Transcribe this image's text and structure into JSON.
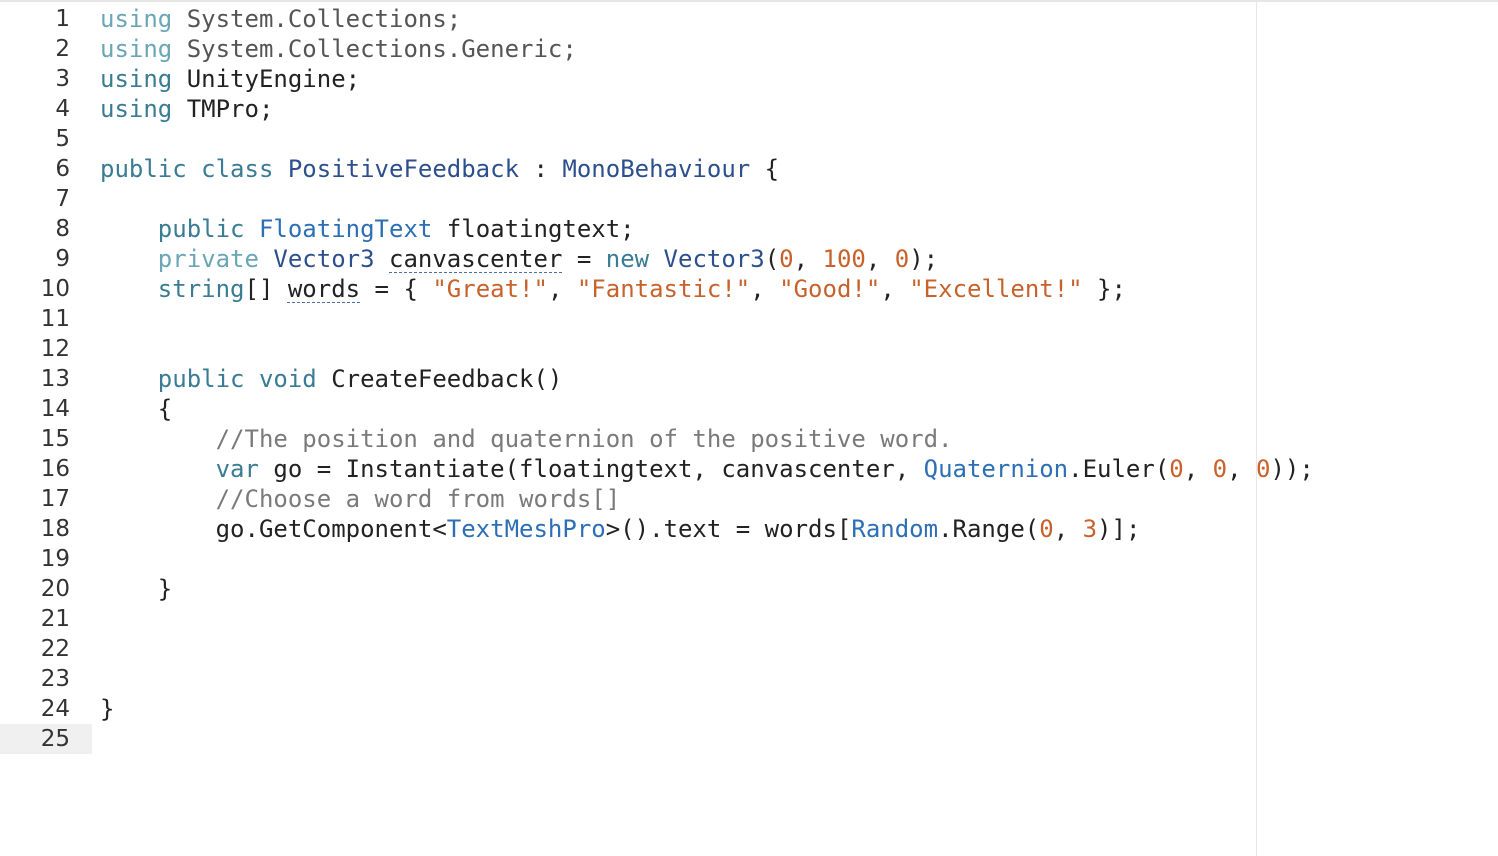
{
  "editor": {
    "language": "C#",
    "current_line": 25,
    "lines": [
      {
        "n": "1",
        "tokens": [
          {
            "t": "using",
            "c": "kwfaded"
          },
          {
            "t": " System.Collections;",
            "c": "ns"
          }
        ]
      },
      {
        "n": "2",
        "tokens": [
          {
            "t": "using",
            "c": "kwfaded"
          },
          {
            "t": " System.Collections.Generic;",
            "c": "ns"
          }
        ]
      },
      {
        "n": "3",
        "tokens": [
          {
            "t": "using",
            "c": "kw"
          },
          {
            "t": " UnityEngine;",
            "c": "plain"
          }
        ]
      },
      {
        "n": "4",
        "tokens": [
          {
            "t": "using",
            "c": "kw"
          },
          {
            "t": " TMPro;",
            "c": "plain"
          }
        ]
      },
      {
        "n": "5",
        "tokens": []
      },
      {
        "n": "6",
        "tokens": [
          {
            "t": "public class ",
            "c": "kw"
          },
          {
            "t": "PositiveFeedback",
            "c": "type"
          },
          {
            "t": " : ",
            "c": "plain"
          },
          {
            "t": "MonoBehaviour",
            "c": "type"
          },
          {
            "t": " {",
            "c": "plain"
          }
        ]
      },
      {
        "n": "7",
        "tokens": []
      },
      {
        "n": "8",
        "tokens": [
          {
            "t": "    ",
            "c": "plain"
          },
          {
            "t": "public ",
            "c": "kw"
          },
          {
            "t": "FloatingText",
            "c": "typeb"
          },
          {
            "t": " floatingtext;",
            "c": "plain"
          }
        ]
      },
      {
        "n": "9",
        "tokens": [
          {
            "t": "    ",
            "c": "plain"
          },
          {
            "t": "private ",
            "c": "kwfaded"
          },
          {
            "t": "Vector3",
            "c": "type"
          },
          {
            "t": " ",
            "c": "plain"
          },
          {
            "t": "canvascenter",
            "c": "plain squiggle"
          },
          {
            "t": " = ",
            "c": "plain"
          },
          {
            "t": "new ",
            "c": "kw"
          },
          {
            "t": "Vector3",
            "c": "type"
          },
          {
            "t": "(",
            "c": "plain"
          },
          {
            "t": "0",
            "c": "num"
          },
          {
            "t": ", ",
            "c": "plain"
          },
          {
            "t": "100",
            "c": "num"
          },
          {
            "t": ", ",
            "c": "plain"
          },
          {
            "t": "0",
            "c": "num"
          },
          {
            "t": ");",
            "c": "plain"
          }
        ]
      },
      {
        "n": "10",
        "tokens": [
          {
            "t": "    ",
            "c": "plain"
          },
          {
            "t": "string",
            "c": "kw"
          },
          {
            "t": "[] ",
            "c": "plain"
          },
          {
            "t": "words",
            "c": "plain squiggle"
          },
          {
            "t": " = { ",
            "c": "plain"
          },
          {
            "t": "\"Great!\"",
            "c": "str"
          },
          {
            "t": ", ",
            "c": "plain"
          },
          {
            "t": "\"Fantastic!\"",
            "c": "str"
          },
          {
            "t": ", ",
            "c": "plain"
          },
          {
            "t": "\"Good!\"",
            "c": "str"
          },
          {
            "t": ", ",
            "c": "plain"
          },
          {
            "t": "\"Excellent!\"",
            "c": "str"
          },
          {
            "t": " };",
            "c": "plain"
          }
        ]
      },
      {
        "n": "11",
        "tokens": []
      },
      {
        "n": "12",
        "tokens": []
      },
      {
        "n": "13",
        "tokens": [
          {
            "t": "    ",
            "c": "plain"
          },
          {
            "t": "public void ",
            "c": "kw"
          },
          {
            "t": "CreateFeedback()",
            "c": "plain"
          }
        ]
      },
      {
        "n": "14",
        "tokens": [
          {
            "t": "    {",
            "c": "plain"
          }
        ]
      },
      {
        "n": "15",
        "tokens": [
          {
            "t": "        ",
            "c": "plain"
          },
          {
            "t": "//The position and quaternion of the positive word.",
            "c": "cm"
          }
        ]
      },
      {
        "n": "16",
        "tokens": [
          {
            "t": "        ",
            "c": "plain"
          },
          {
            "t": "var",
            "c": "kw"
          },
          {
            "t": " go = Instantiate(floatingtext, canvascenter, ",
            "c": "plain"
          },
          {
            "t": "Quaternion",
            "c": "typeb"
          },
          {
            "t": ".Euler(",
            "c": "plain"
          },
          {
            "t": "0",
            "c": "num"
          },
          {
            "t": ", ",
            "c": "plain"
          },
          {
            "t": "0",
            "c": "num"
          },
          {
            "t": ", ",
            "c": "plain"
          },
          {
            "t": "0",
            "c": "num"
          },
          {
            "t": "));",
            "c": "plain"
          }
        ]
      },
      {
        "n": "17",
        "tokens": [
          {
            "t": "        ",
            "c": "plain"
          },
          {
            "t": "//Choose a word from words[]",
            "c": "cm"
          }
        ]
      },
      {
        "n": "18",
        "tokens": [
          {
            "t": "        ",
            "c": "plain"
          },
          {
            "t": "go.GetComponent<",
            "c": "plain"
          },
          {
            "t": "TextMeshPro",
            "c": "typeb"
          },
          {
            "t": ">().text = words[",
            "c": "plain"
          },
          {
            "t": "Random",
            "c": "typeb"
          },
          {
            "t": ".Range(",
            "c": "plain"
          },
          {
            "t": "0",
            "c": "num"
          },
          {
            "t": ", ",
            "c": "plain"
          },
          {
            "t": "3",
            "c": "num"
          },
          {
            "t": ")];",
            "c": "plain"
          }
        ]
      },
      {
        "n": "19",
        "tokens": []
      },
      {
        "n": "20",
        "tokens": [
          {
            "t": "    }",
            "c": "plain"
          }
        ]
      },
      {
        "n": "21",
        "tokens": []
      },
      {
        "n": "22",
        "tokens": []
      },
      {
        "n": "23",
        "tokens": []
      },
      {
        "n": "24",
        "tokens": [
          {
            "t": "}",
            "c": "plain"
          }
        ]
      },
      {
        "n": "25",
        "tokens": []
      }
    ]
  }
}
